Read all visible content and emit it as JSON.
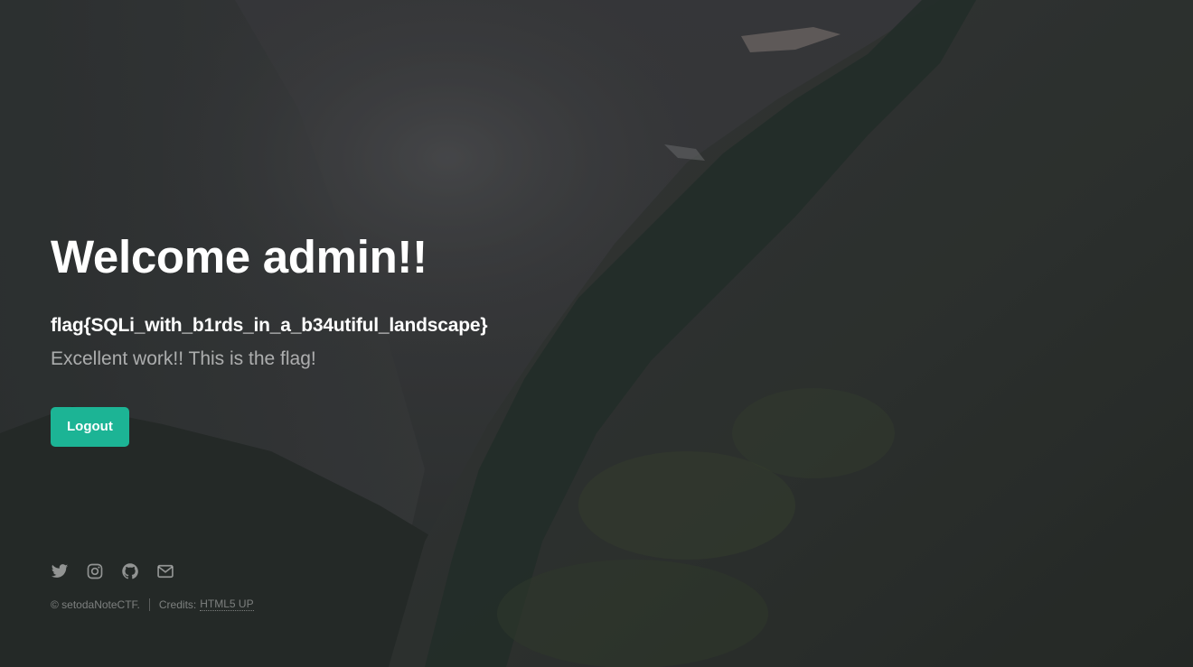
{
  "page": {
    "title": "Welcome admin!!",
    "flag": "flag{SQLi_with_b1rds_in_a_b34utiful_landscape}",
    "subtitle": "Excellent work!! This is the flag!"
  },
  "actions": {
    "logout_label": "Logout"
  },
  "footer": {
    "social_icons": [
      "twitter-icon",
      "instagram-icon",
      "github-icon",
      "envelope-icon"
    ],
    "copyright": "© setodaNoteCTF.",
    "credits_label": "Credits:",
    "credits_link": "HTML5 UP"
  },
  "colors": {
    "accent": "#1cb495",
    "text": "#ffffff",
    "background": "#2b2e30"
  }
}
